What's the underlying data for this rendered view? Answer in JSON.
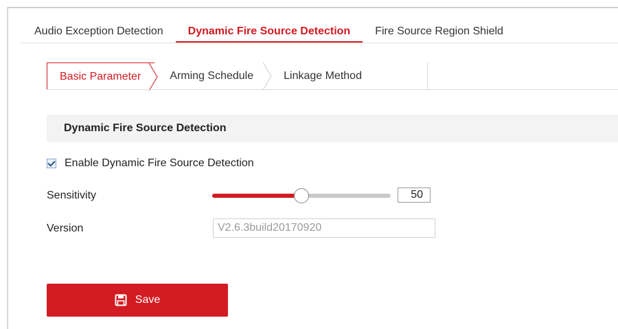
{
  "top_tabs": [
    {
      "label": "Audio Exception Detection",
      "active": false
    },
    {
      "label": "Dynamic Fire Source Detection",
      "active": true
    },
    {
      "label": "Fire Source Region Shield",
      "active": false
    }
  ],
  "sub_tabs": [
    {
      "label": "Basic Parameter",
      "active": true
    },
    {
      "label": "Arming Schedule",
      "active": false
    },
    {
      "label": "Linkage Method",
      "active": false
    }
  ],
  "section": {
    "title": "Dynamic Fire Source Detection"
  },
  "enable": {
    "label": "Enable Dynamic Fire Source Detection",
    "checked": true
  },
  "sensitivity": {
    "label": "Sensitivity",
    "value": "50",
    "level": 0.5
  },
  "version": {
    "label": "Version",
    "value": "V2.6.3build20170920"
  },
  "save": {
    "label": "Save",
    "icon": "save-icon"
  },
  "colors": {
    "accent": "#d21b22"
  }
}
